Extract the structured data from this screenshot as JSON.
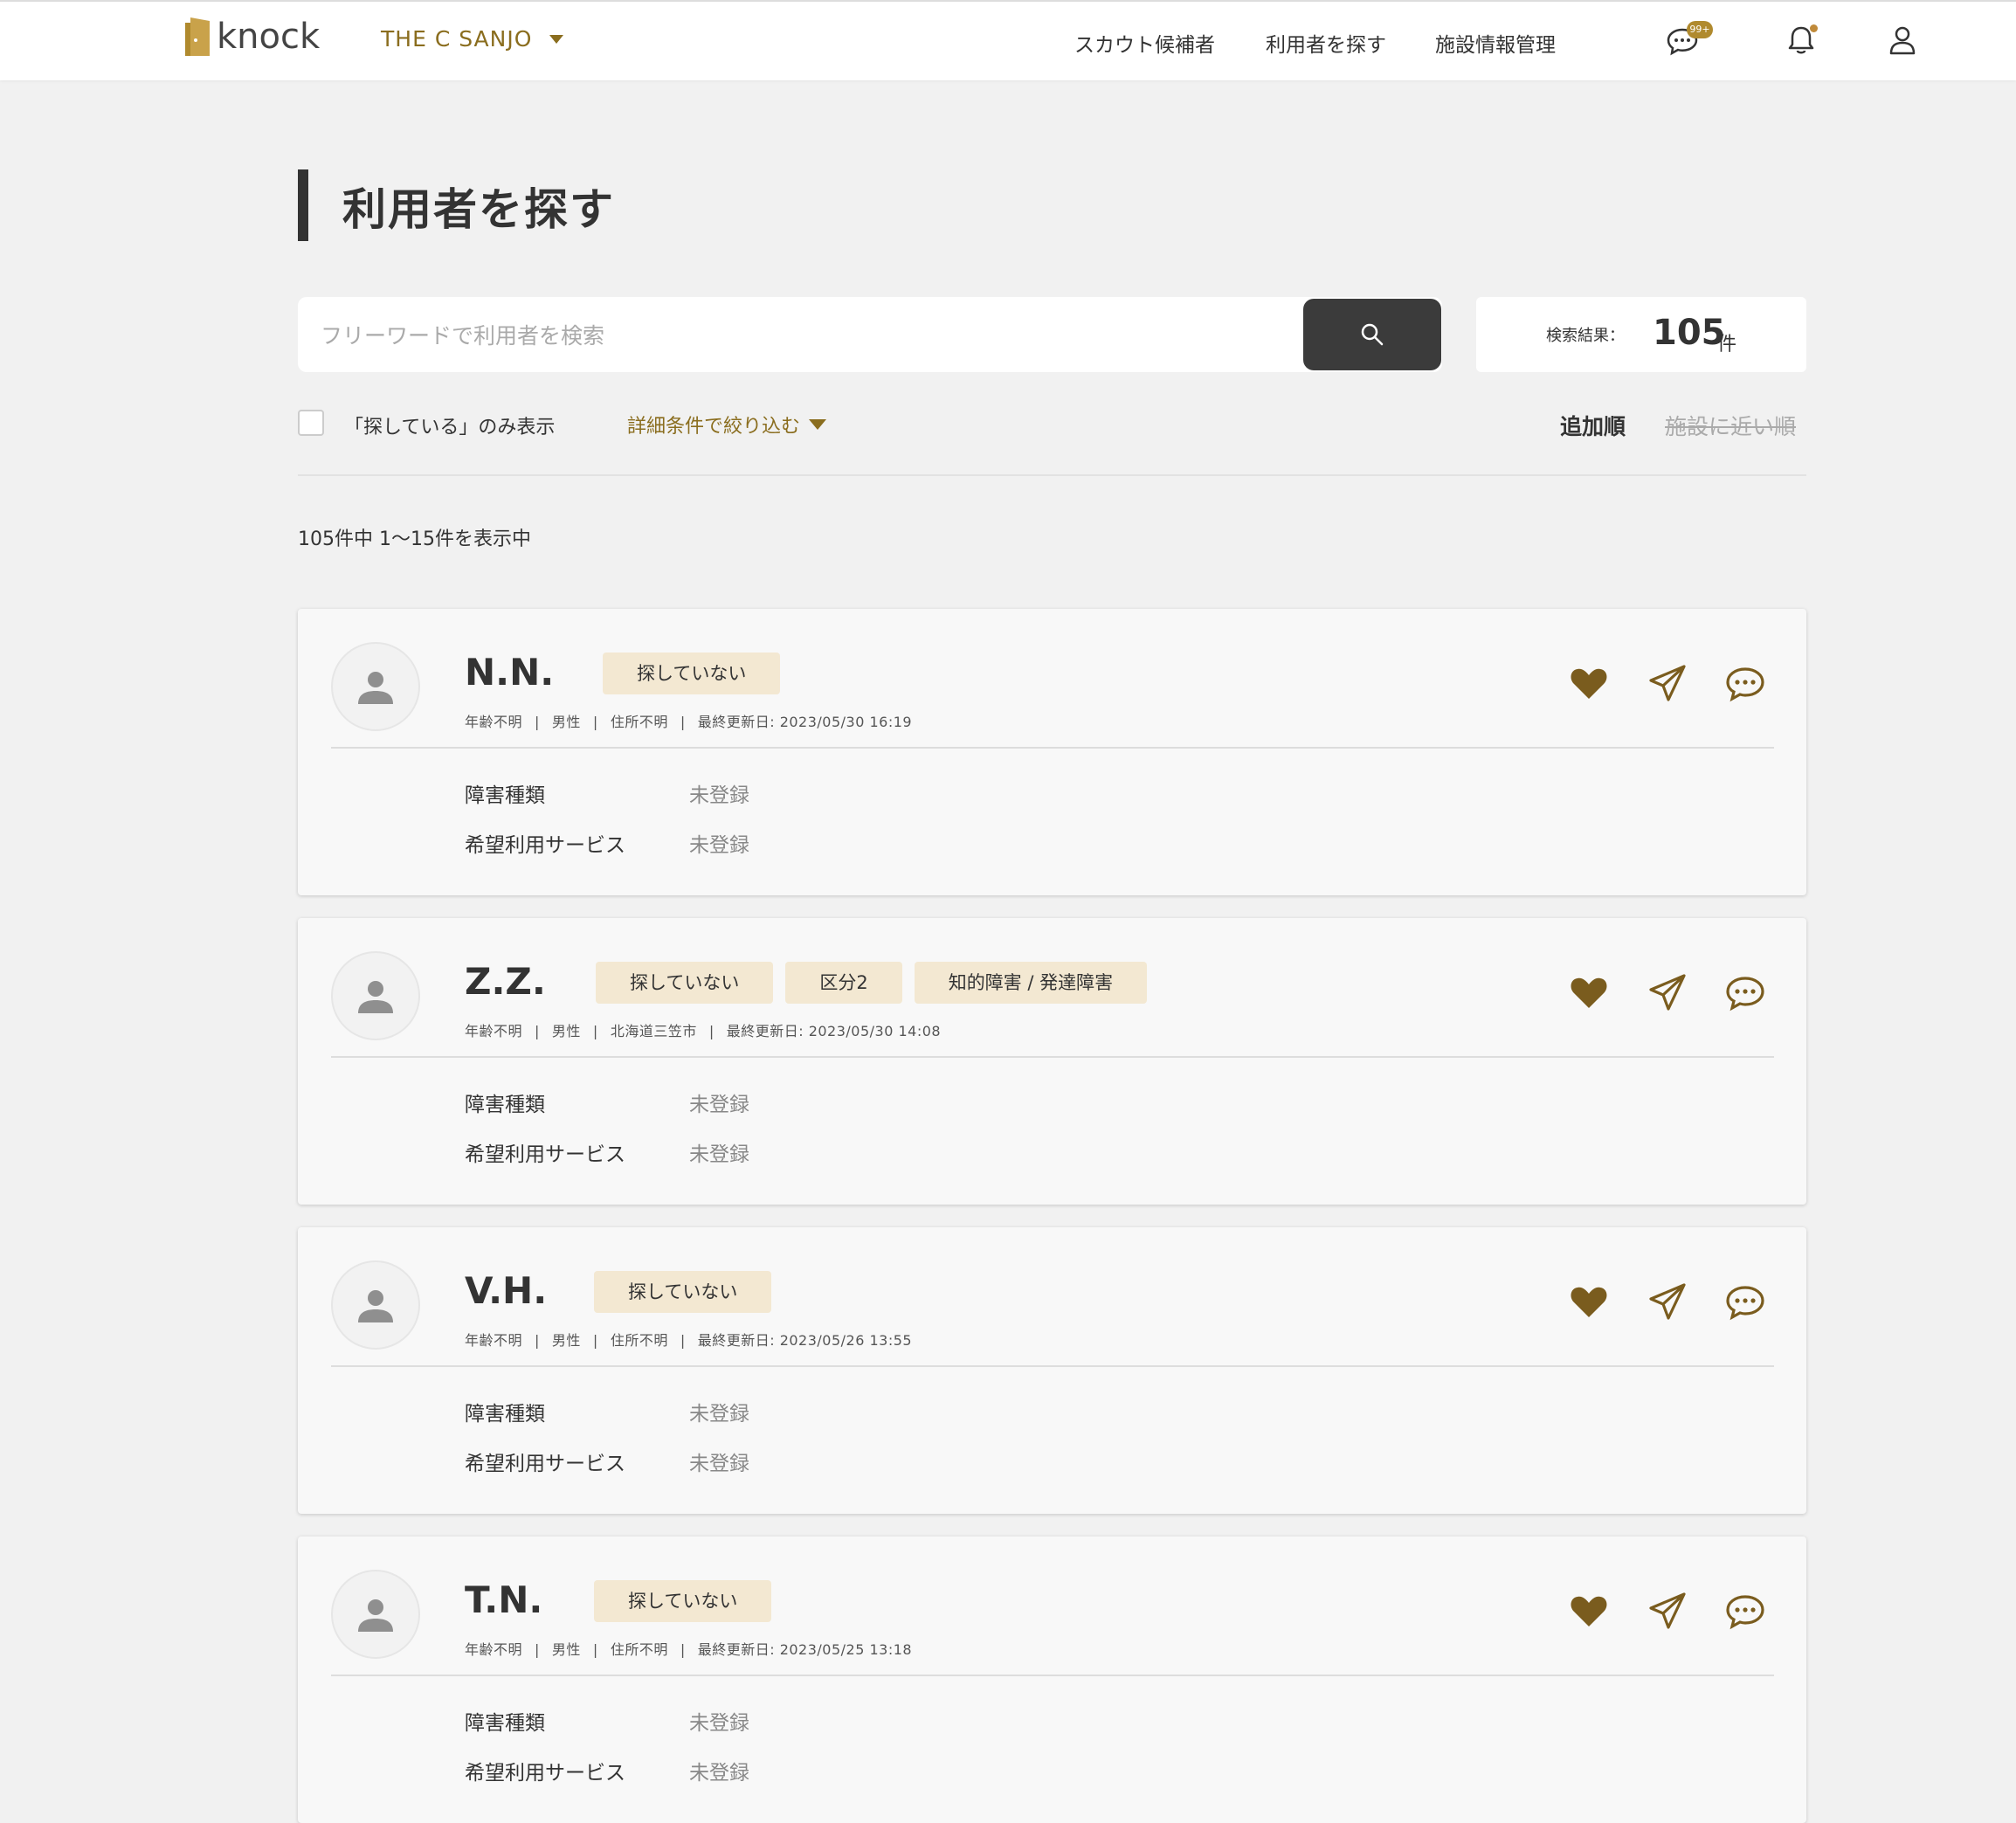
{
  "header": {
    "logo_text": "knock",
    "facility_name": "THE C SANJO",
    "nav": [
      "スカウト候補者",
      "利用者を探す",
      "施設情報管理"
    ],
    "message_badge": "99+",
    "brand_color": "#8a6d1e"
  },
  "page": {
    "title": "利用者を探す"
  },
  "search": {
    "placeholder": "フリーワードで利用者を検索",
    "result_label": "検索結果：",
    "result_count": "105",
    "result_unit": "件"
  },
  "filters": {
    "only_searching_label": "「探している」のみ表示",
    "detail_filter_label": "詳細条件で絞り込む",
    "sort_added": "追加順",
    "sort_near": "施設に近い順"
  },
  "range_text": "105件中 1〜15件を表示中",
  "cards": [
    {
      "name": "N.N.",
      "tags": [
        "探していない"
      ],
      "age": "年齢不明",
      "gender": "男性",
      "address": "住所不明",
      "updated": "最終更新日: 2023/05/30 16:19",
      "disability_label": "障害種類",
      "disability_value": "未登録",
      "service_label": "希望利用サービス",
      "service_value": "未登録"
    },
    {
      "name": "Z.Z.",
      "tags": [
        "探していない",
        "区分2",
        "知的障害 / 発達障害"
      ],
      "age": "年齢不明",
      "gender": "男性",
      "address": "北海道三笠市",
      "updated": "最終更新日: 2023/05/30 14:08",
      "disability_label": "障害種類",
      "disability_value": "未登録",
      "service_label": "希望利用サービス",
      "service_value": "未登録"
    },
    {
      "name": "V.H.",
      "tags": [
        "探していない"
      ],
      "age": "年齢不明",
      "gender": "男性",
      "address": "住所不明",
      "updated": "最終更新日: 2023/05/26 13:55",
      "disability_label": "障害種類",
      "disability_value": "未登録",
      "service_label": "希望利用サービス",
      "service_value": "未登録"
    },
    {
      "name": "T.N.",
      "tags": [
        "探していない"
      ],
      "age": "年齢不明",
      "gender": "男性",
      "address": "住所不明",
      "updated": "最終更新日: 2023/05/25 13:18",
      "disability_label": "障害種類",
      "disability_value": "未登録",
      "service_label": "希望利用サービス",
      "service_value": "未登録"
    }
  ]
}
